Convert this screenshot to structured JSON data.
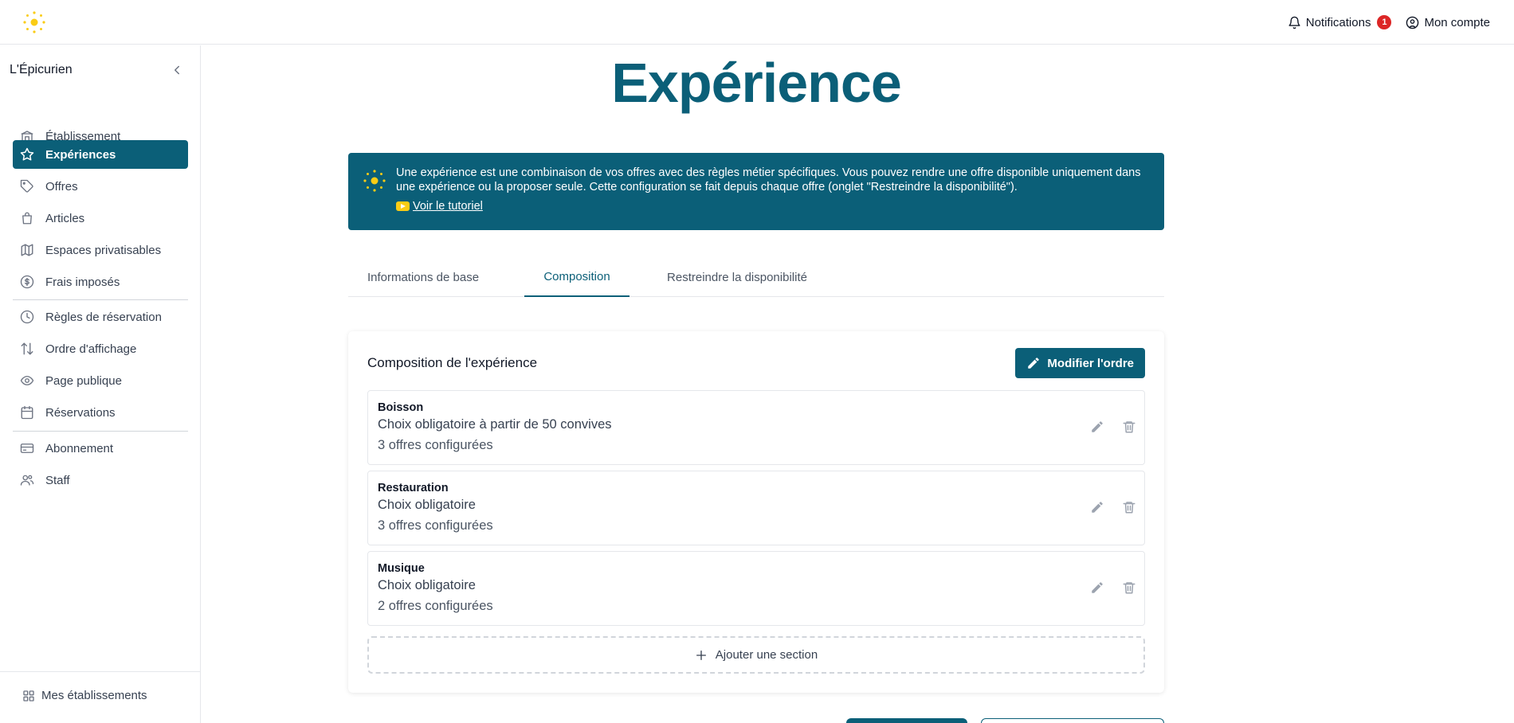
{
  "header": {
    "notifications_label": "Notifications",
    "notifications_count": "1",
    "account_label": "Mon compte"
  },
  "sidebar": {
    "title": "L'Épicurien",
    "items": [
      {
        "label": "Établissement",
        "icon": "building-icon"
      },
      {
        "label": "Expériences",
        "icon": "star-icon",
        "active": true
      },
      {
        "label": "Offres",
        "icon": "tag-icon"
      },
      {
        "label": "Articles",
        "icon": "shopping-bag-icon"
      },
      {
        "label": "Espaces privatisables",
        "icon": "map-icon"
      },
      {
        "label": "Frais imposés",
        "icon": "dollar-icon"
      },
      {
        "label": "Règles de réservation",
        "icon": "clock-icon"
      },
      {
        "label": "Ordre d'affichage",
        "icon": "sort-arrows-icon"
      },
      {
        "label": "Page publique",
        "icon": "eye-icon"
      },
      {
        "label": "Réservations",
        "icon": "calendar-icon"
      },
      {
        "label": "Abonnement",
        "icon": "credit-card-icon"
      },
      {
        "label": "Staff",
        "icon": "users-icon"
      }
    ],
    "footer_label": "Mes établissements"
  },
  "main": {
    "title": "Expérience",
    "info": {
      "text": "Une expérience est une combinaison de vos offres avec des règles métier spécifiques. Vous pouvez rendre une offre disponible uniquement dans une expérience ou la proposer seule. Cette configuration se fait depuis chaque offre (onglet \"Restreindre la disponibilité\").",
      "link_label": "Voir le tutoriel"
    },
    "tabs": [
      {
        "label": "Informations de base"
      },
      {
        "label": "Composition",
        "active": true
      },
      {
        "label": "Restreindre la disponibilité"
      }
    ],
    "composition": {
      "title": "Composition de l'expérience",
      "edit_order_label": "Modifier l'ordre",
      "sections": [
        {
          "name": "Boisson",
          "rule": "Choix obligatoire à partir de 50 convives",
          "count": "3 offres configurées"
        },
        {
          "name": "Restauration",
          "rule": "Choix obligatoire",
          "count": "3 offres configurées"
        },
        {
          "name": "Musique",
          "rule": "Choix obligatoire",
          "count": "2 offres configurées"
        }
      ],
      "add_section_label": "Ajouter une section"
    }
  },
  "colors": {
    "brand": "#0b5f78",
    "accent_yellow": "#facc15",
    "badge_red": "#dc2626"
  }
}
